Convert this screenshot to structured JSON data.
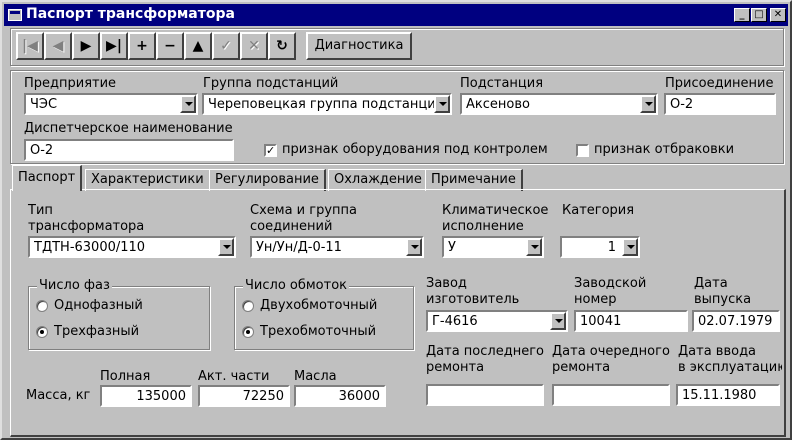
{
  "window": {
    "title": "Паспорт трансформатора",
    "buttons": [
      "minimize",
      "maximize",
      "close"
    ]
  },
  "toolbar": {
    "nav": [
      {
        "name": "first-record-button",
        "glyph": "|◀",
        "enabled": false
      },
      {
        "name": "prior-record-button",
        "glyph": "◀",
        "enabled": false
      },
      {
        "name": "next-record-button",
        "glyph": "▶",
        "enabled": true
      },
      {
        "name": "last-record-button",
        "glyph": "▶|",
        "enabled": true
      },
      {
        "name": "insert-record-button",
        "glyph": "+",
        "enabled": true
      },
      {
        "name": "delete-record-button",
        "glyph": "−",
        "enabled": true
      },
      {
        "name": "edit-record-button",
        "glyph": "▲",
        "enabled": true
      },
      {
        "name": "post-record-button",
        "glyph": "✓",
        "enabled": false
      },
      {
        "name": "cancel-record-button",
        "glyph": "✕",
        "enabled": false
      },
      {
        "name": "refresh-button",
        "glyph": "↻",
        "enabled": true
      }
    ],
    "diagnostics_label": "Диагностика"
  },
  "header": {
    "enterprise_label": "Предприятие",
    "enterprise_value": "ЧЭС",
    "group_label": "Группа подстанций",
    "group_value": "Череповецкая группа подстанций",
    "substation_label": "Подстанция",
    "substation_value": "Аксеново",
    "connection_label": "Присоединение",
    "connection_value": "О-2",
    "dispatch_label": "Диспетчерское наименование",
    "dispatch_value": "О-2",
    "under_control_label": "признак оборудования под контролем",
    "under_control_checked": true,
    "rejected_label": "признак отбраковки",
    "rejected_checked": false
  },
  "tabs": [
    {
      "label": "Паспорт",
      "active": true
    },
    {
      "label": "Характеристики",
      "active": false
    },
    {
      "label": "Регулирование",
      "active": false
    },
    {
      "label": "Охлаждение",
      "active": false
    },
    {
      "label": "Примечание",
      "active": false
    }
  ],
  "passport": {
    "type_label_1": "Тип",
    "type_label_2": "трансформатора",
    "type_value": "ТДТН-63000/110",
    "scheme_label_1": "Схема и группа",
    "scheme_label_2": "соединений",
    "scheme_value": "Ун/Ун/Д-0-11",
    "climate_label_1": "Климатическое",
    "climate_label_2": "исполнение",
    "climate_value": "У",
    "category_label": "Категория",
    "category_value": "1",
    "phases_group": "Число фаз",
    "phase_options": [
      {
        "label": "Однофазный",
        "selected": false
      },
      {
        "label": "Трехфазный",
        "selected": true
      }
    ],
    "windings_group": "Число обмоток",
    "winding_options": [
      {
        "label": "Двухобмоточный",
        "selected": false
      },
      {
        "label": "Трехобмоточный",
        "selected": true
      }
    ],
    "factory_label_1": "Завод",
    "factory_label_2": "изготовитель",
    "factory_value": "Г-4616",
    "serial_label_1": "Заводской",
    "serial_label_2": "номер",
    "serial_value": "10041",
    "release_label_1": "Дата",
    "release_label_2": "выпуска",
    "release_value": "02.07.1979",
    "last_repair_label_1": "Дата последнего",
    "last_repair_label_2": "ремонта",
    "last_repair_value": "",
    "next_repair_label_1": "Дата очередного",
    "next_repair_label_2": "ремонта",
    "next_repair_value": "",
    "commission_label_1": "Дата ввода",
    "commission_label_2": "в эксплуатацию",
    "commission_value": "15.11.1980",
    "mass_label": "Масса, кг",
    "mass_full_label": "Полная",
    "mass_full_value": "135000",
    "mass_active_label": "Акт. части",
    "mass_active_value": "72250",
    "mass_oil_label": "Масла",
    "mass_oil_value": "36000"
  }
}
